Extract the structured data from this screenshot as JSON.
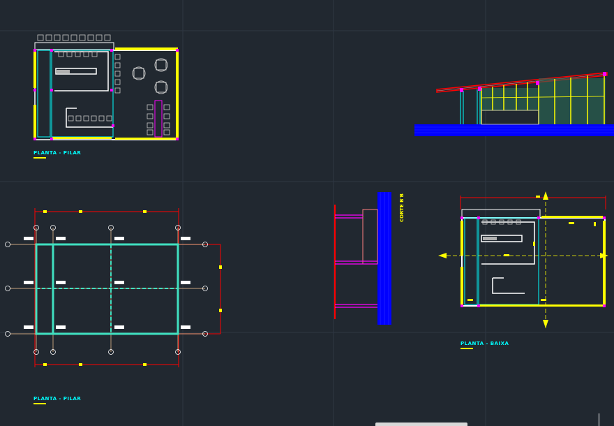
{
  "drawing": {
    "labels": {
      "plan_top": "PLANTA - PILAR",
      "plan_bottom": "PLANTA - PILAR",
      "plan_right": "PLANTA - BAIXA",
      "section": "CORTE B'B"
    },
    "colors": {
      "background": "#212830",
      "grid": "#2e3742",
      "wall": "#ffffff",
      "column": "#ffff00",
      "cyan": "#00ffff",
      "magenta": "#ff00ff",
      "red": "#ff0000",
      "blue": "#0000ff",
      "pink": "#ff7f7f",
      "teal": "#40e0c0"
    }
  }
}
